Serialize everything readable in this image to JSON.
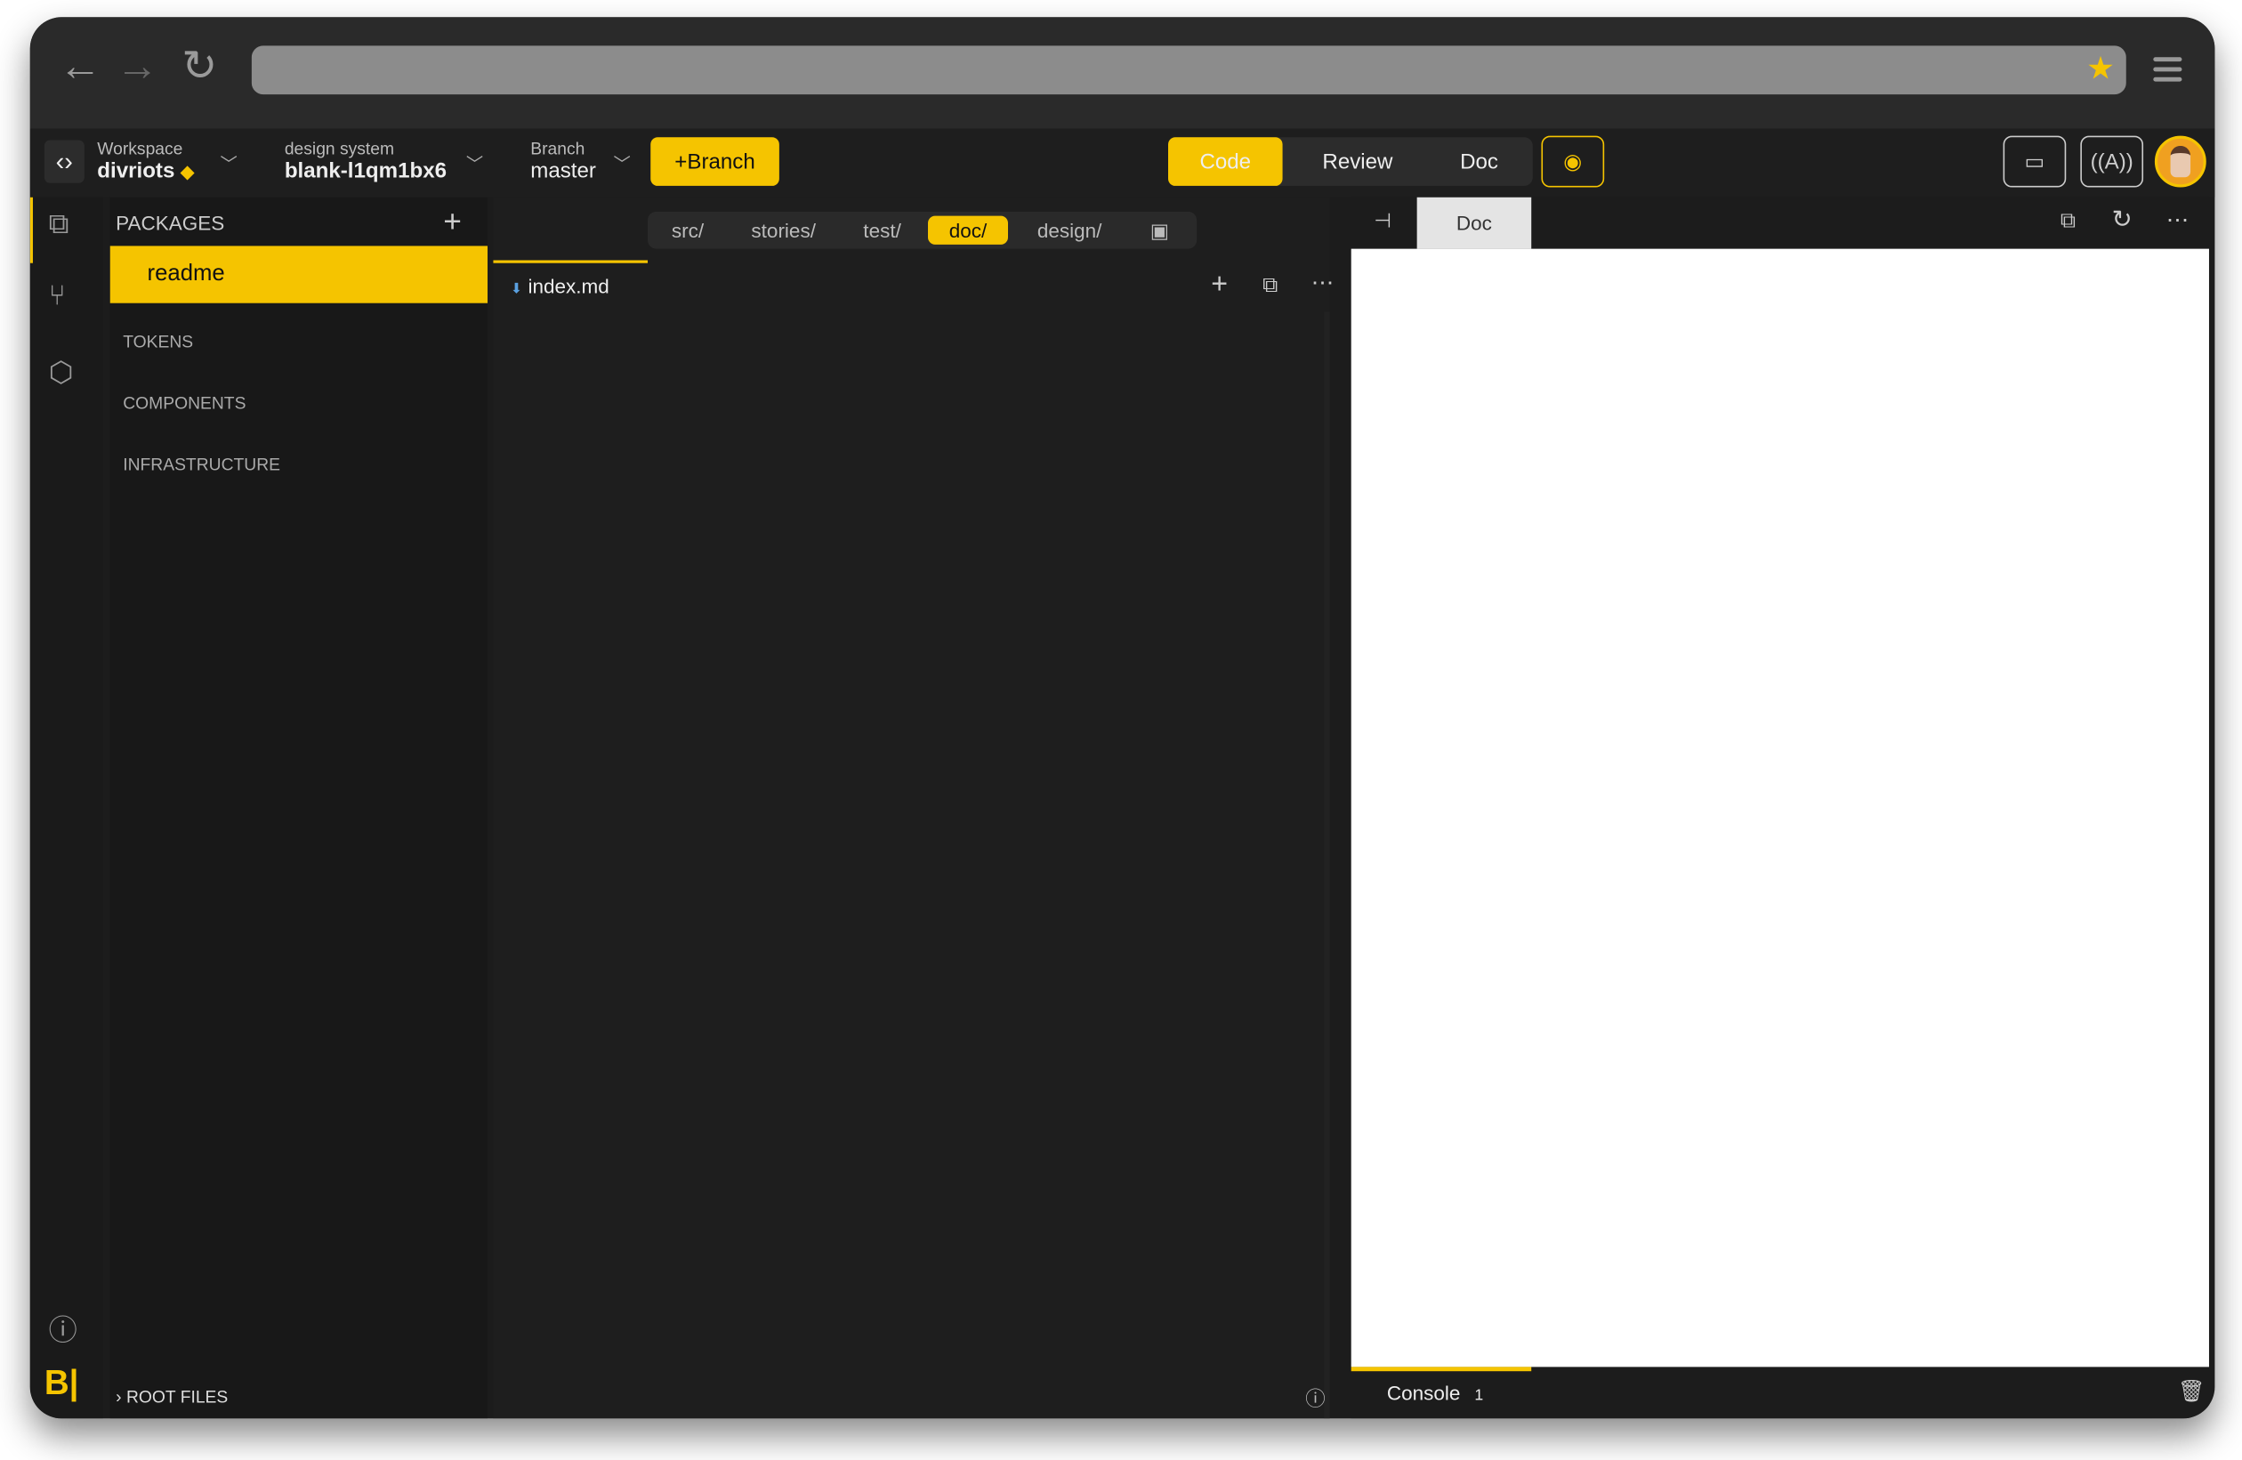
{
  "browser": {
    "back_icon": "arrow-left",
    "forward_icon": "arrow-right",
    "reload_icon": "reload",
    "address": "",
    "star_color": "#f5c400"
  },
  "header": {
    "workspace": {
      "label": "Workspace",
      "value": "divriots"
    },
    "design_system": {
      "label": "design system",
      "value": "blank-l1qm1bx6"
    },
    "branch": {
      "label": "Branch",
      "value": "master"
    },
    "new_branch_label": "+Branch",
    "modes": [
      {
        "label": "Code",
        "active": true
      },
      {
        "label": "Review",
        "active": false
      },
      {
        "label": "Doc",
        "active": false
      }
    ]
  },
  "packages": {
    "title": "PACKAGES",
    "selected": "readme",
    "sections": [
      "TOKENS",
      "COMPONENTS",
      "INFRASTRUCTURE"
    ],
    "root_files": "ROOT FILES"
  },
  "editor": {
    "folders": [
      "src/",
      "stories/",
      "test/",
      "doc/",
      "design/"
    ],
    "active_folder": "doc/",
    "open_file": "index.md"
  },
  "preview": {
    "tab": "Doc",
    "console_label": "Console",
    "console_count": "1"
  },
  "colors": {
    "accent": "#f5c400",
    "bg": "#1e1e1e"
  }
}
